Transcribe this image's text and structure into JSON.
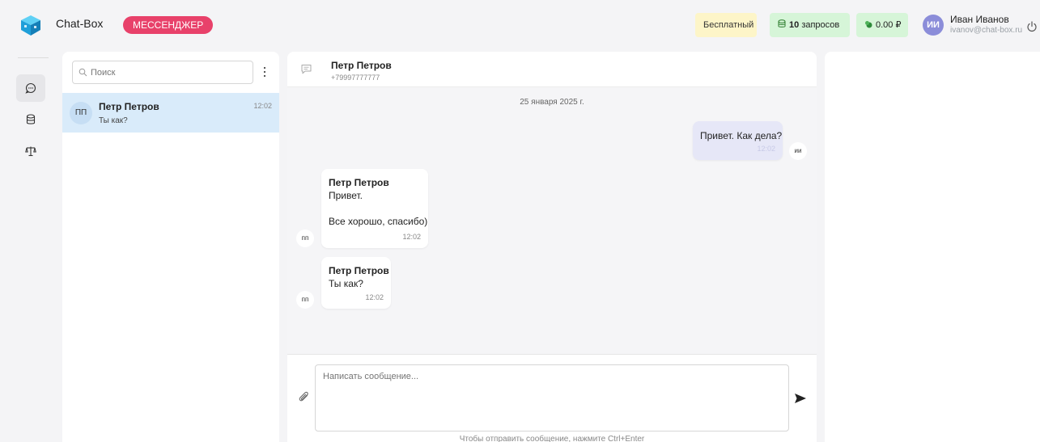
{
  "header": {
    "app_title": "Chat-Box",
    "app_badge": "МЕССЕНДЖЕР",
    "plan_label": "Бесплатный",
    "requests_count": "10",
    "requests_label": "запросов",
    "balance": "0.00 ₽",
    "user": {
      "initials": "ИИ",
      "name": "Иван Иванов",
      "email": "ivanov@chat-box.ru"
    }
  },
  "nav": {
    "items": [
      "chat-icon",
      "database-icon",
      "scales-icon"
    ],
    "active": "chat-icon"
  },
  "chat_list": {
    "search_placeholder": "Поиск",
    "items": [
      {
        "initials": "ПП",
        "name": "Петр Петров",
        "preview": "Ты как?",
        "time": "12:02"
      }
    ]
  },
  "conversation": {
    "contact_name": "Петр Петров",
    "contact_phone": "+79997777777",
    "date_separator": "25 января 2025 г.",
    "messages": [
      {
        "own": true,
        "text": "Привет. Как дела?",
        "time": "12:02",
        "avatar": "ии"
      },
      {
        "own": false,
        "author": "Петр Петров",
        "text": "Привет.\n\nВсе хорошо, спасибо)",
        "time": "12:02",
        "avatar": "пп"
      },
      {
        "own": false,
        "author": "Петр Петров",
        "text": "Ты как?",
        "time": "12:02",
        "avatar": "пп"
      }
    ],
    "input_placeholder": "Написать сообщение...",
    "hint": "Чтобы отправить сообщение, нажмите Ctrl+Enter"
  },
  "colors": {
    "accent_badge": "#e8416a",
    "selected_chat": "#d9ebfa",
    "own_bubble": "#e6e7f7",
    "green_chip": "#d6f5d8",
    "plan_chip": "#fdf5c8"
  }
}
